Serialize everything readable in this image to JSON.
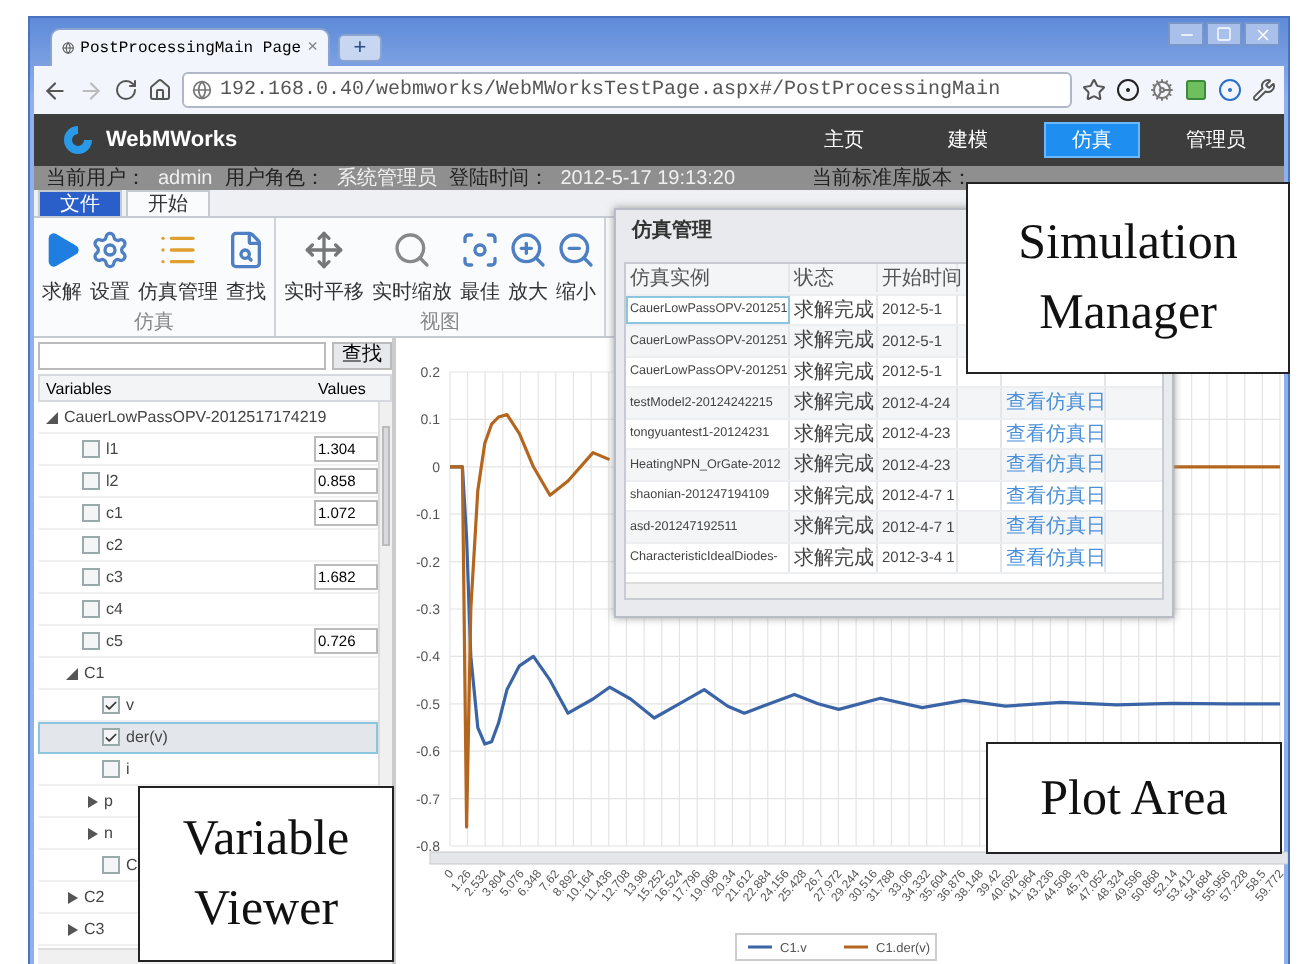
{
  "browser": {
    "tab": {
      "title": "PostProcessingMain Page",
      "close": "×",
      "selected": true
    },
    "new_tab": "+",
    "url": "192.168.0.40/webmworks/WebMWorksTestPage.aspx#/PostProcessingMain"
  },
  "app": {
    "logo": "WebMWorks",
    "nav": [
      {
        "label": "主页",
        "selected": false
      },
      {
        "label": "建模",
        "selected": false
      },
      {
        "label": "仿真",
        "selected": true
      },
      {
        "label": "管理员",
        "selected": false
      }
    ],
    "status_bar": [
      {
        "label": "当前用户：",
        "value": "admin"
      },
      {
        "label": "用户角色：",
        "value": "系统管理员"
      },
      {
        "label": "登陆时间：",
        "value": "2012-5-17 19:13:20"
      }
    ],
    "status_right": "当前标准库版本：",
    "ribbon": {
      "tabs": [
        {
          "label": "文件",
          "kind": "menu",
          "selected": false
        },
        {
          "label": "开始",
          "kind": "tab",
          "selected": true
        }
      ],
      "groups": [
        {
          "title": "仿真",
          "buttons": [
            "求解",
            "设置",
            "仿真管理",
            "查找"
          ]
        },
        {
          "title": "视图",
          "buttons": [
            "实时平移",
            "实时缩放",
            "最佳",
            "放大",
            "缩小"
          ]
        }
      ]
    },
    "variables": {
      "search_button": "查找",
      "columns": [
        "Variables",
        "Values"
      ],
      "tree": [
        {
          "kind": "group",
          "label": "CauerLowPassOPV-2012517174219",
          "expanded": true,
          "selected": false,
          "children": [
            {
              "kind": "var",
              "label": "l1",
              "checked": false,
              "selected": false,
              "value": "1.304"
            },
            {
              "kind": "var",
              "label": "l2",
              "checked": false,
              "selected": false,
              "value": "0.858"
            },
            {
              "kind": "var",
              "label": "c1",
              "checked": false,
              "selected": false,
              "value": "1.072"
            },
            {
              "kind": "var",
              "label": "c2",
              "checked": false,
              "selected": false
            },
            {
              "kind": "var",
              "label": "c3",
              "checked": false,
              "selected": false,
              "value": "1.682"
            },
            {
              "kind": "var",
              "label": "c4",
              "checked": false,
              "selected": false
            },
            {
              "kind": "var",
              "label": "c5",
              "checked": false,
              "selected": false,
              "value": "0.726"
            },
            {
              "kind": "group",
              "label": "C1",
              "expanded": true,
              "selected": false,
              "children": [
                {
                  "kind": "var",
                  "label": "v",
                  "checked": true,
                  "selected": false
                },
                {
                  "kind": "var",
                  "label": "der(v)",
                  "checked": true,
                  "selected": true
                },
                {
                  "kind": "var",
                  "label": "i",
                  "checked": false,
                  "selected": false
                },
                {
                  "kind": "group",
                  "label": "p",
                  "expanded": false,
                  "selected": false
                },
                {
                  "kind": "group",
                  "label": "n",
                  "expanded": false,
                  "selected": false
                },
                {
                  "kind": "var",
                  "label": "C",
                  "checked": false,
                  "selected": false
                }
              ]
            },
            {
              "kind": "group",
              "label": "C2",
              "expanded": false,
              "selected": false
            },
            {
              "kind": "group",
              "label": "C3",
              "expanded": false,
              "selected": false
            }
          ]
        }
      ]
    },
    "plot": {
      "chart_data": {
        "type": "line",
        "x": [
          0,
          0.9,
          1.2,
          1.5,
          2,
          2.5,
          3,
          3.5,
          4.1,
          5,
          6,
          7.2,
          8.5,
          10.3,
          11.5,
          13,
          14.7,
          16.5,
          18.3,
          20,
          21.2,
          23,
          24.8,
          26.5,
          28,
          31,
          34,
          37,
          40,
          44,
          48,
          52,
          56,
          59.772
        ],
        "series": [
          {
            "name": "C1.v",
            "color": "#3a64a6",
            "values": [
              0,
              0,
              -0.15,
              -0.4,
              -0.55,
              -0.585,
              -0.58,
              -0.54,
              -0.47,
              -0.42,
              -0.4,
              -0.45,
              -0.52,
              -0.49,
              -0.465,
              -0.49,
              -0.53,
              -0.5,
              -0.47,
              -0.505,
              -0.52,
              -0.5,
              -0.48,
              -0.5,
              -0.512,
              -0.488,
              -0.508,
              -0.493,
              -0.505,
              -0.497,
              -0.502,
              -0.499,
              -0.5,
              -0.5
            ]
          },
          {
            "name": "C1.der(v)",
            "color": "#b5661e",
            "values": [
              0,
              0,
              -0.76,
              -0.3,
              -0.05,
              0.05,
              0.09,
              0.105,
              0.11,
              0.07,
              0,
              -0.06,
              -0.03,
              0.03,
              0.015,
              null,
              null,
              null,
              null,
              null,
              null,
              null,
              null,
              null,
              null,
              null,
              null,
              null,
              null,
              null,
              null,
              0,
              0,
              0
            ]
          }
        ],
        "grid": true,
        "legend": true,
        "xlim": [
          0,
          59.772
        ],
        "ylim": [
          -0.8,
          0.2
        ],
        "xticks": [
          0,
          1.26,
          2.532,
          3.804,
          5.076,
          6.348,
          7.62,
          8.892,
          10.164,
          11.436,
          12.708,
          13.98,
          15.252,
          16.524,
          17.796,
          19.068,
          20.34,
          21.612,
          22.884,
          24.156,
          25.428,
          26.7,
          27.972,
          29.244,
          30.516,
          31.788,
          33.06,
          34.332,
          35.604,
          36.876,
          38.148,
          39.42,
          40.692,
          41.964,
          43.236,
          44.508,
          45.78,
          47.052,
          48.324,
          49.596,
          50.868,
          52.14,
          53.412,
          54.684,
          55.956,
          57.228,
          58.5,
          59.772
        ],
        "yticks": [
          0.2,
          0.1,
          0,
          -0.1,
          -0.2,
          -0.3,
          -0.4,
          -0.5,
          -0.6,
          -0.7,
          -0.8
        ]
      }
    },
    "sim_manager": {
      "title": "仿真管理",
      "columns": [
        "仿真实例",
        "状态",
        "开始时间"
      ],
      "rows": [
        {
          "name": "CauerLowPassOPV-201251",
          "status": "求解完成",
          "start": "2012-5-1",
          "selected": true
        },
        {
          "name": "CauerLowPassOPV-201251",
          "status": "求解完成",
          "start": "2012-5-1",
          "selected": false
        },
        {
          "name": "CauerLowPassOPV-201251",
          "status": "求解完成",
          "start": "2012-5-1",
          "selected": false
        },
        {
          "name": "testModel2-20124242215",
          "status": "求解完成",
          "start": "2012-4-24",
          "link": "查看仿真日",
          "selected": false
        },
        {
          "name": "tongyuantest1-20124231",
          "status": "求解完成",
          "start": "2012-4-23",
          "link": "查看仿真日",
          "selected": false
        },
        {
          "name": "HeatingNPN_OrGate-2012",
          "status": "求解完成",
          "start": "2012-4-23",
          "link": "查看仿真日",
          "selected": false
        },
        {
          "name": "shaonian-201247194109",
          "status": "求解完成",
          "start": "2012-4-7 1",
          "link": "查看仿真日",
          "selected": false
        },
        {
          "name": "asd-201247192511",
          "status": "求解完成",
          "start": "2012-4-7 1",
          "link": "查看仿真日",
          "selected": false
        },
        {
          "name": "CharacteristicIdealDiodes-",
          "status": "求解完成",
          "start": "2012-3-4 1",
          "link": "查看仿真日",
          "selected": false
        }
      ]
    }
  },
  "callouts": [
    "Simulation Manager",
    "Plot Area",
    "Variable Viewer"
  ]
}
